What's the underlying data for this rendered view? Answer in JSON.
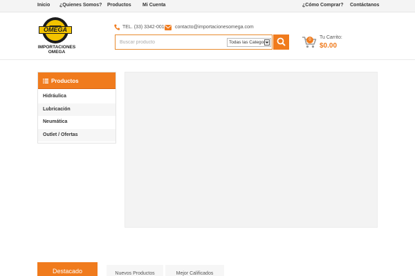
{
  "topnav": {
    "left": [
      "Inicio",
      "¿Quienes Somos?",
      "Productos",
      "Mi Cuenta"
    ],
    "right": [
      "¿Cómo Comprar?",
      "Contáctanos"
    ]
  },
  "logo": {
    "word": "OMEGA",
    "subtitle": "IMPORTACIONES OMEGA"
  },
  "contact": {
    "phone": "TEL. (33) 3342-0018",
    "email": "contacto@importacionesomega.com"
  },
  "search": {
    "placeholder": "Buscar producto",
    "category_selected": "Todas las Categor"
  },
  "cart": {
    "count": "0",
    "label": "Tu Carrito:",
    "total": "$0.00"
  },
  "sidebar": {
    "title": "Productos",
    "items": [
      "Hidráulica",
      "Lubricación",
      "Neumática",
      "Outlet / Ofertas"
    ]
  },
  "tabs": [
    "Destacado",
    "Nuevos Productos",
    "Mejor Calificados"
  ],
  "colors": {
    "accent": "#f07b1d",
    "topbar": "#f4f4f4",
    "logo_yellow": "#f4c400"
  },
  "icons": {
    "phone": "phone-icon",
    "email": "envelope-icon",
    "search": "search-icon",
    "cart": "cart-icon",
    "menu": "list-icon"
  }
}
